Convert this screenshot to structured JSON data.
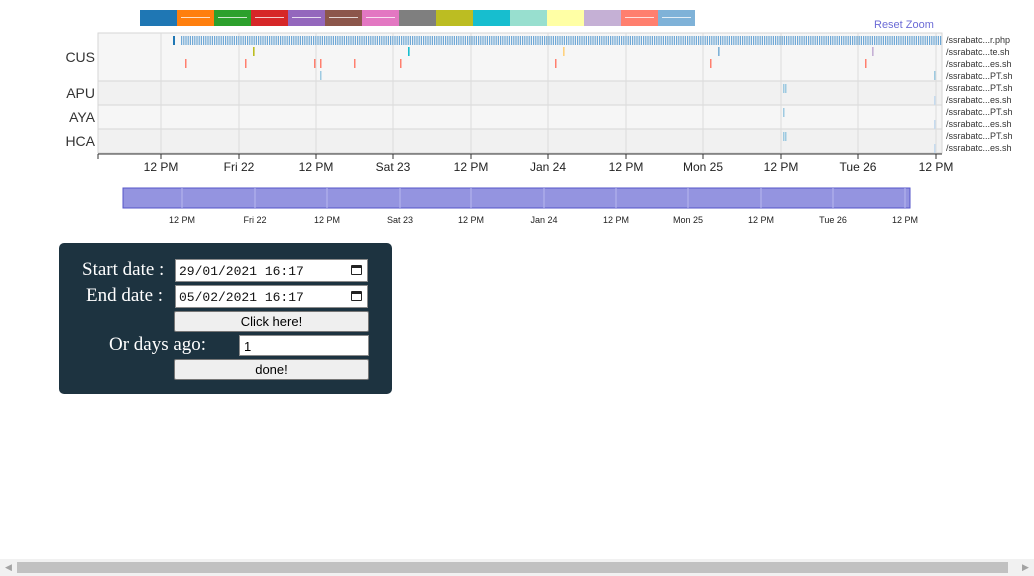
{
  "legend_colors": [
    "#1f77b4",
    "#ff7f0e",
    "#2ca02c",
    "#d62728",
    "#9467bd",
    "#8c564b",
    "#e377c2",
    "#7f7f7f",
    "#bcbd22",
    "#17becf",
    "#98dfcf",
    "#ffffa5",
    "#c5b0d5",
    "#ff7f6e",
    "#7fb2d8"
  ],
  "legend_strike": [
    false,
    true,
    true,
    true,
    true,
    true,
    true,
    false,
    false,
    false,
    false,
    false,
    false,
    true,
    true
  ],
  "reset_zoom": "Reset Zoom",
  "timeline": {
    "groups": [
      {
        "name": "CUS",
        "rows": [
          "/ssrabatc...r.php",
          "/ssrabatc...te.sh",
          "/ssrabatc...es.sh",
          "/ssrabatc...PT.sh"
        ]
      },
      {
        "name": "APU",
        "rows": [
          "/ssrabatc...PT.sh",
          "/ssrabatc...es.sh"
        ]
      },
      {
        "name": "AYA",
        "rows": [
          "/ssrabatc...PT.sh",
          "/ssrabatc...es.sh"
        ]
      },
      {
        "name": "HCA",
        "rows": [
          "/ssrabatc...PT.sh",
          "/ssrabatc...es.sh"
        ]
      }
    ],
    "tick_labels": [
      "12 PM",
      "Fri 22",
      "12 PM",
      "Sat 23",
      "12 PM",
      "Jan 24",
      "12 PM",
      "Mon 25",
      "12 PM",
      "Tue 26",
      "12 PM"
    ],
    "mark_colors": {
      "php": "#1f77b4",
      "te": [
        "#bcbd22",
        "#17becf",
        "#c5b0d5",
        "#7fb2d8"
      ],
      "es": "#ff7f6e",
      "pt": "#9ecae1"
    }
  },
  "brush": {
    "fill": "#9494e0",
    "tick_labels": [
      "12 PM",
      "Fri 22",
      "12 PM",
      "Sat 23",
      "12 PM",
      "Jan 24",
      "12 PM",
      "Mon 25",
      "12 PM",
      "Tue 26",
      "12 PM"
    ]
  },
  "form": {
    "start_label": "Start date :",
    "start_value": "29/01/2021 16:17",
    "end_label": "End date :",
    "end_value": "05/02/2021 16:17",
    "click_label": "Click here!",
    "days_label": "Or days ago:",
    "days_value": "1",
    "done_label": "done!"
  }
}
